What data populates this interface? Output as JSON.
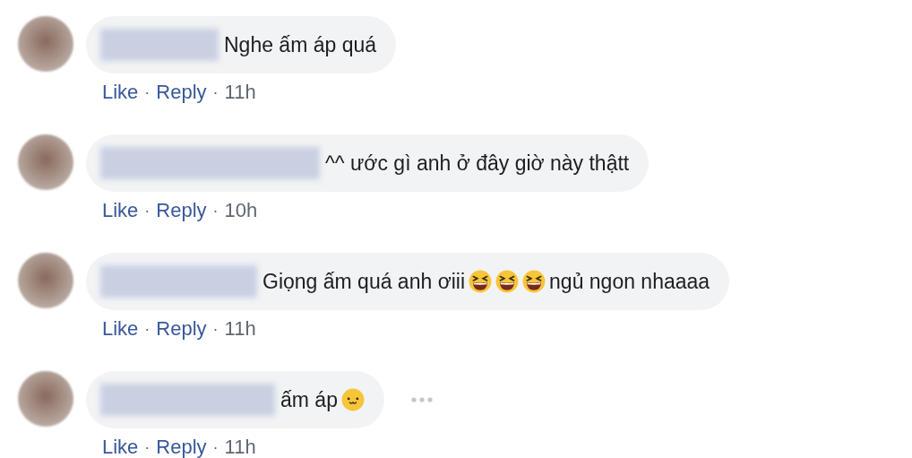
{
  "comments": [
    {
      "parts": [
        {
          "kind": "text",
          "text": "Nghe ấm áp quá"
        }
      ],
      "actions": [
        {
          "kind": "link",
          "text": "Like"
        },
        {
          "kind": "sep",
          "text": "·"
        },
        {
          "kind": "link",
          "text": "Reply"
        },
        {
          "kind": "sep",
          "text": "·"
        },
        {
          "kind": "time",
          "text": "11h"
        }
      ],
      "has_menu": false
    },
    {
      "parts": [
        {
          "kind": "text",
          "text": "^^ ước gì anh ở đây giờ này thậtt"
        }
      ],
      "actions": [
        {
          "kind": "link",
          "text": "Like"
        },
        {
          "kind": "sep",
          "text": "·"
        },
        {
          "kind": "link",
          "text": "Reply"
        },
        {
          "kind": "sep",
          "text": "·"
        },
        {
          "kind": "time",
          "text": "10h"
        }
      ],
      "has_menu": false
    },
    {
      "parts": [
        {
          "kind": "text",
          "text": "Giọng ấm quá anh ơiii"
        },
        {
          "kind": "laughing-emoji"
        },
        {
          "kind": "laughing-emoji"
        },
        {
          "kind": "laughing-emoji"
        },
        {
          "kind": "text",
          "text": "ngủ ngon nhaaaa"
        }
      ],
      "actions": [
        {
          "kind": "link",
          "text": "Like"
        },
        {
          "kind": "sep",
          "text": "·"
        },
        {
          "kind": "link",
          "text": "Reply"
        },
        {
          "kind": "sep",
          "text": "·"
        },
        {
          "kind": "time",
          "text": "11h"
        }
      ],
      "has_menu": false
    },
    {
      "parts": [
        {
          "kind": "text",
          "text": "ấm áp"
        },
        {
          "kind": "smiling-emoji"
        }
      ],
      "actions": [
        {
          "kind": "link",
          "text": "Like"
        },
        {
          "kind": "sep",
          "text": "·"
        },
        {
          "kind": "link",
          "text": "Reply"
        },
        {
          "kind": "sep",
          "text": "·"
        },
        {
          "kind": "time",
          "text": "11h"
        }
      ],
      "has_menu": true
    }
  ]
}
